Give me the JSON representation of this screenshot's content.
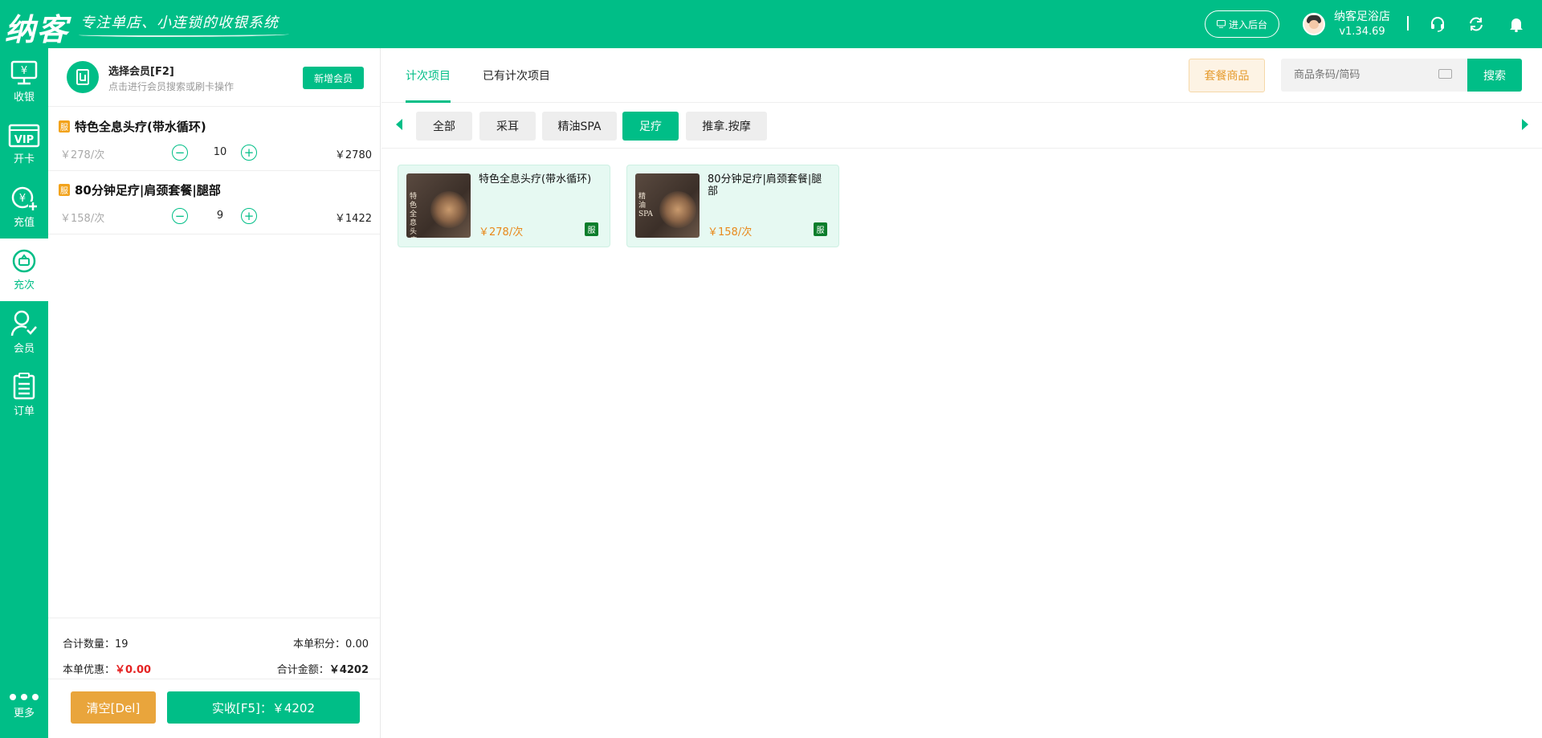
{
  "header": {
    "logo": "纳客",
    "slogan": "专注单店、小连锁的收银系统",
    "backend_button": "进入后台",
    "store_name": "纳客足浴店",
    "version": "v1.34.69",
    "icons": [
      "headset-icon",
      "sync-icon",
      "bell-icon"
    ]
  },
  "nav": {
    "items": [
      {
        "label": "收银",
        "icon": "cashier-icon"
      },
      {
        "label": "开卡",
        "icon": "vip-card-icon"
      },
      {
        "label": "充值",
        "icon": "recharge-icon"
      },
      {
        "label": "充次",
        "icon": "recharge-times-icon"
      },
      {
        "label": "会员",
        "icon": "member-icon"
      },
      {
        "label": "订单",
        "icon": "order-icon"
      }
    ],
    "more_label": "更多",
    "active": "充次"
  },
  "member": {
    "title": "选择会员[F2]",
    "subtitle": "点击进行会员搜索或刷卡操作",
    "new_button": "新增会员"
  },
  "cart": {
    "badge": "服",
    "items": [
      {
        "name": "特色全息头疗(带水循环)",
        "unit_price": "￥278/次",
        "qty": "10",
        "total": "￥2780"
      },
      {
        "name": "80分钟足疗|肩颈套餐|腿部",
        "unit_price": "￥158/次",
        "qty": "9",
        "total": "￥1422"
      }
    ]
  },
  "summary": {
    "total_qty_label": "合计数量：",
    "total_qty": "19",
    "points_label": "本单积分：",
    "points": "0.00",
    "discount_label": "本单优惠：",
    "discount": "￥0.00",
    "amount_label": "合计金额：",
    "amount": "￥4202",
    "clear_button": "清空[Del]",
    "pay_button": "实收[F5]：￥4202"
  },
  "tabs": {
    "items": [
      "计次项目",
      "已有计次项目"
    ],
    "active": "计次项目"
  },
  "toolbar": {
    "package_button": "套餐商品",
    "search_placeholder": "商品条码/简码",
    "search_button": "搜索"
  },
  "categories": {
    "items": [
      "全部",
      "采耳",
      "精油SPA",
      "足疗",
      "推拿.按摩"
    ],
    "active": "足疗"
  },
  "products": [
    {
      "name": "特色全息头疗(带水循环)",
      "price": "￥278/次",
      "badge": "服",
      "image_text": "特色全息头疗"
    },
    {
      "name": "80分钟足疗|肩颈套餐|腿部",
      "price": "￥158/次",
      "badge": "服",
      "image_text": "精油SPA"
    }
  ],
  "colors": {
    "brand": "#00be87",
    "price": "#e8891b",
    "discount": "#e52323",
    "clear_button": "#e9a53c",
    "service_badge": "#0b7d2b"
  }
}
